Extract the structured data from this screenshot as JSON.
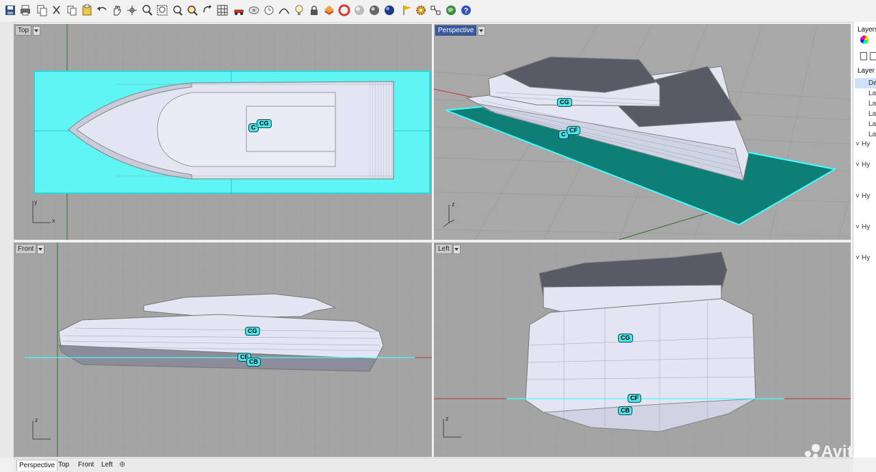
{
  "toolbar": {
    "icons": [
      "save-icon",
      "print-icon",
      "copy-icon",
      "cut-icon",
      "paste-icon",
      "undo-icon",
      "pan-icon",
      "move-icon",
      "zoom-icon",
      "zoom-window-icon",
      "zoom-extents-icon",
      "zoom-selected-icon",
      "rotate-view-icon",
      "grid-icon",
      "car-icon",
      "lightbulb-icon",
      "lock-icon",
      "layer-icon",
      "material-icon",
      "render-icon",
      "sphere-icon",
      "flag-icon",
      "gear-icon",
      "analysis-icon",
      "globe-icon",
      "help-icon"
    ]
  },
  "viewports": {
    "top": {
      "label": "Top",
      "axis_x": "x",
      "axis_y": "y"
    },
    "perspective": {
      "label": "Perspective",
      "axis_z": "z"
    },
    "front": {
      "label": "Front",
      "axis_z": "z"
    },
    "left": {
      "label": "Left",
      "axis_z": "z"
    }
  },
  "markers": {
    "cg": "CG",
    "cf": "CF",
    "cb": "CB",
    "cb_clipped": "C"
  },
  "layers_panel": {
    "title": "Layers",
    "header": "Layer",
    "rows": [
      "De",
      "Lay",
      "Lay",
      "Lay",
      "Lay",
      "Lay"
    ],
    "groups": [
      "Hy",
      "Hy",
      "Hy",
      "Hy",
      "Hy"
    ]
  },
  "tabs": [
    "Perspective",
    "Top",
    "Front",
    "Left"
  ],
  "watermark": "Avito",
  "colors": {
    "viewport_bg": "#a4a4a4",
    "cyan_plane": "#5ff5f5",
    "teal_plane": "#0d7f77",
    "hull": "#e3e6f2",
    "active_label": "#3a5aa0"
  }
}
